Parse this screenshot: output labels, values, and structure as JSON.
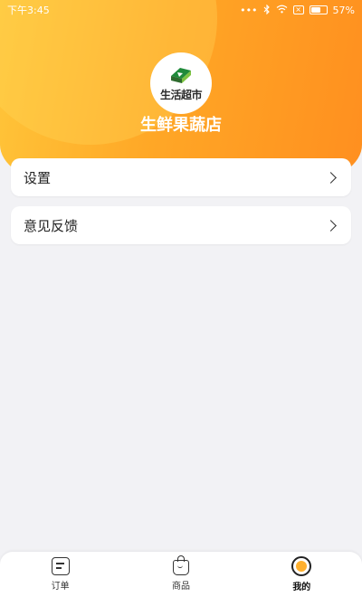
{
  "status_bar": {
    "time": "下午3:45",
    "battery": "57%"
  },
  "profile": {
    "logo_text": "生活超市",
    "store_name": "生鲜果蔬店"
  },
  "menu": {
    "items": [
      {
        "label": "设置"
      },
      {
        "label": "意见反馈"
      }
    ]
  },
  "tabbar": {
    "tabs": [
      {
        "label": "订单",
        "icon": "order-icon"
      },
      {
        "label": "商品",
        "icon": "bag-icon"
      },
      {
        "label": "我的",
        "icon": "profile-icon",
        "active": true
      }
    ]
  },
  "colors": {
    "accent_start": "#ffc63a",
    "accent_end": "#ff8f1f",
    "background": "#f2f2f5"
  }
}
